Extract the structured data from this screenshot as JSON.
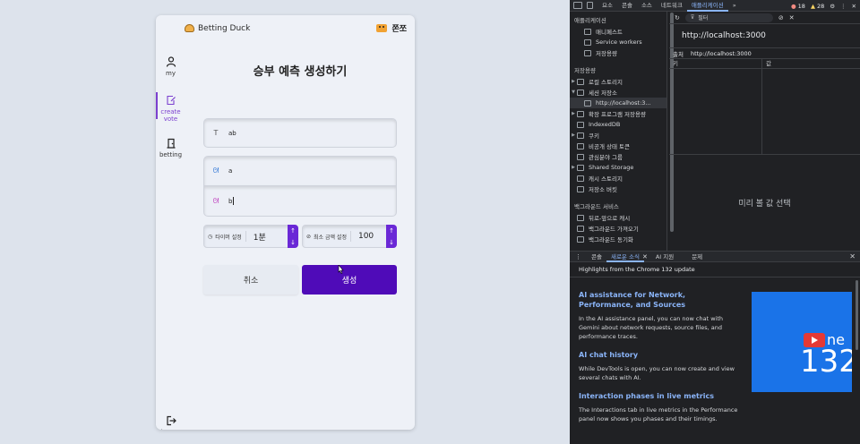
{
  "app": {
    "brand": "Betting Duck",
    "user_name": "쫀쪼",
    "sidebar": [
      {
        "label": "my",
        "icon": "user-icon"
      },
      {
        "label": "create vote",
        "icon": "edit-icon"
      },
      {
        "label": "betting",
        "icon": "door-icon"
      }
    ],
    "logout_label": "logout",
    "page_title": "승부 예측 생성하기",
    "title_field_value": "ab",
    "option_a_value": "a",
    "option_b_value": "b",
    "timer_label": "타이머 설정",
    "timer_value": "1분",
    "min_amount_label": "최소 금액 설정",
    "min_amount_value": "100",
    "cancel_label": "취소",
    "create_label": "생성",
    "accent_color": "#4f0bb8"
  },
  "devtools": {
    "tabs": [
      "요소",
      "콘솔",
      "소스",
      "네트워크",
      "애플리케이션"
    ],
    "active_tab": "애플리케이션",
    "error_count": "18",
    "warning_count": "28",
    "sections": {
      "application_header": "애플리케이션",
      "application_items": [
        "매니페스트",
        "Service workers",
        "저장용량"
      ],
      "storage_header": "저장용량",
      "storage_items": [
        "로컬 스토리지",
        "세션 저장소",
        "http://localhost:3...",
        "확장 프로그램 저장용량",
        "IndexedDB",
        "쿠키",
        "비공개 상태 토큰",
        "관심분야 그룹",
        "Shared Storage",
        "캐시 스토리지",
        "저장소 버킷"
      ],
      "background_header": "백그라운드 서비스",
      "background_items": [
        "뒤로-앞으로 캐시",
        "백그라운드 가져오기",
        "백그라운드 동기화"
      ]
    },
    "filter_placeholder": "필터",
    "url_display": "http://localhost:3000",
    "origin_label": "출처",
    "origin_value": "http://localhost:3000",
    "col_key": "키",
    "col_value": "값",
    "preview_text": "미리 볼 값 선택",
    "drawer_tabs": [
      "콘솔",
      "새로운 소식",
      "AI 지원",
      "문제"
    ],
    "drawer_active": "새로운 소식",
    "news_header": "Highlights from the Chrome 132 update",
    "news": [
      {
        "heading": "AI assistance for Network, Performance, and Sources",
        "text": "In the AI assistance panel, you can now chat with Gemini about network requests, source files, and performance traces."
      },
      {
        "heading": "AI chat history",
        "text": "While DevTools is open, you can now create and view several chats with AI."
      },
      {
        "heading": "Interaction phases in live metrics",
        "text": "The Interactions tab in live metrics in the Performance panel now shows you phases and their timings."
      }
    ],
    "news_image_number": "132",
    "news_image_text": "ne"
  }
}
